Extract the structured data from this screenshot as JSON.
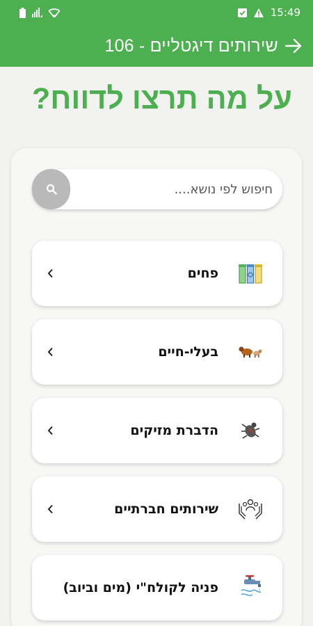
{
  "status_bar": {
    "time": "15:49",
    "left_icons": [
      "battery-icon",
      "signal-bars-icon",
      "wifi-icon"
    ],
    "right_icons": [
      "notification-icon",
      "warning-icon"
    ]
  },
  "app_bar": {
    "title": "שירותים דיגטליים - 106",
    "back_icon": "arrow-right-icon",
    "color": "#4caf50"
  },
  "heading": "על מה תרצו לדווח?",
  "search": {
    "placeholder": "חיפוש לפי נושא....",
    "value": ""
  },
  "categories": [
    {
      "label": "פחים",
      "icon": "recycle-bins-icon"
    },
    {
      "label": "בעלי-חיים",
      "icon": "animals-icon"
    },
    {
      "label": "הדברת מזיקים",
      "icon": "pest-control-icon"
    },
    {
      "label": "שירותים חברתיים",
      "icon": "social-services-icon"
    },
    {
      "label": "פניה לקולח\"י (מים וביוב)",
      "icon": "water-faucet-icon"
    }
  ],
  "colors": {
    "accent": "#4caf50",
    "background": "#f2f2f0",
    "search_button": "#b9b9b9"
  }
}
